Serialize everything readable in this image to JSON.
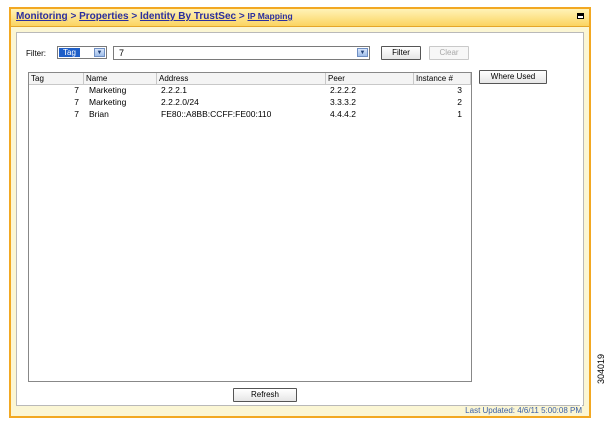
{
  "breadcrumb": {
    "items": [
      "Monitoring",
      "Properties",
      "Identity By TrustSec",
      "IP Mapping"
    ],
    "separator": ">"
  },
  "filter": {
    "label": "Filter:",
    "field": "Tag",
    "value": "7",
    "filter_button": "Filter",
    "clear_button": "Clear"
  },
  "table": {
    "columns": [
      "Tag",
      "Name",
      "Address",
      "Peer",
      "Instance #"
    ],
    "rows": [
      {
        "tag": "7",
        "name": "Marketing",
        "address": "2.2.2.1",
        "peer": "2.2.2.2",
        "instance": "3"
      },
      {
        "tag": "7",
        "name": "Marketing",
        "address": "2.2.2.0/24",
        "peer": "3.3.3.2",
        "instance": "2"
      },
      {
        "tag": "7",
        "name": "Brian",
        "address": "FE80::A8BB:CCFF:FE00:110",
        "peer": "4.4.4.2",
        "instance": "1"
      }
    ]
  },
  "actions": {
    "where_used": "Where Used",
    "refresh": "Refresh"
  },
  "status": {
    "last_updated": "Last Updated: 4/6/11 5:00:08 PM"
  },
  "figure_id": "304019",
  "colors": {
    "window_border": "#f2a822",
    "window_bg": "#fbf6d4",
    "link": "#2b2f9e",
    "selection": "#1f5fc8"
  }
}
